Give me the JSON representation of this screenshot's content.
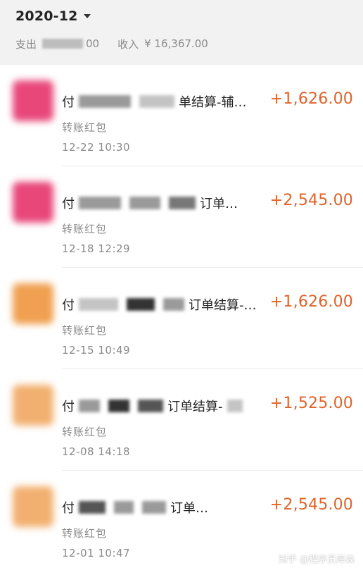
{
  "header": {
    "month": "2020-12",
    "expense_label": "支出",
    "expense_value_visible": "00",
    "income_label": "收入",
    "income_value": "¥ 16,367.00"
  },
  "transactions": [
    {
      "title_prefix": "付",
      "title_suffix": "单结算-辅…",
      "type": "转账红包",
      "time": "12-22  10:30",
      "amount": "+1,626.00",
      "avatar_color": "#e8477a"
    },
    {
      "title_prefix": "付",
      "title_suffix": "订单…",
      "type": "转账红包",
      "time": "12-18  12:29",
      "amount": "+2,545.00",
      "avatar_color": "#e8477a"
    },
    {
      "title_prefix": "付",
      "title_suffix": "订单结算-…",
      "type": "转账红包",
      "time": "12-15  10:49",
      "amount": "+1,626.00",
      "avatar_color": "#f0a050"
    },
    {
      "title_prefix": "付",
      "title_suffix": "订单结算-",
      "type": "转账红包",
      "time": "12-08  14:18",
      "amount": "+1,525.00",
      "avatar_color": "#f2b070"
    },
    {
      "title_prefix": "付",
      "title_suffix": "订单…",
      "type": "转账红包",
      "time": "12-01  10:47",
      "amount": "+2,545.00",
      "avatar_color": "#f2b070"
    }
  ],
  "watermark": "知乎 @程序员库森",
  "colors": {
    "amount": "#e0622a",
    "header_bg": "#f2f2f2"
  }
}
